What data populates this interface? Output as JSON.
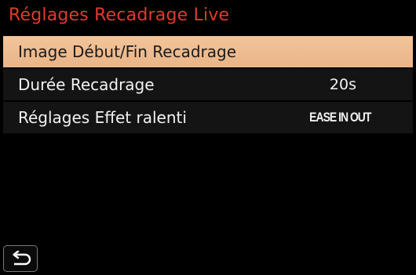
{
  "screen": {
    "title": "Réglages Recadrage Live"
  },
  "menu": {
    "items": [
      {
        "label": "Image Début/Fin Recadrage",
        "value": "",
        "selected": true
      },
      {
        "label": "Durée Recadrage",
        "value": "20s",
        "selected": false
      },
      {
        "label": "Réglages Effet ralenti",
        "value": "EASE IN OUT",
        "selected": false
      }
    ]
  },
  "icons": {
    "back": "return-arrow-icon"
  },
  "colors": {
    "title": "#e23a2a",
    "selected_row": "#f0bf94",
    "row_background": "#141414",
    "background": "#000000"
  }
}
